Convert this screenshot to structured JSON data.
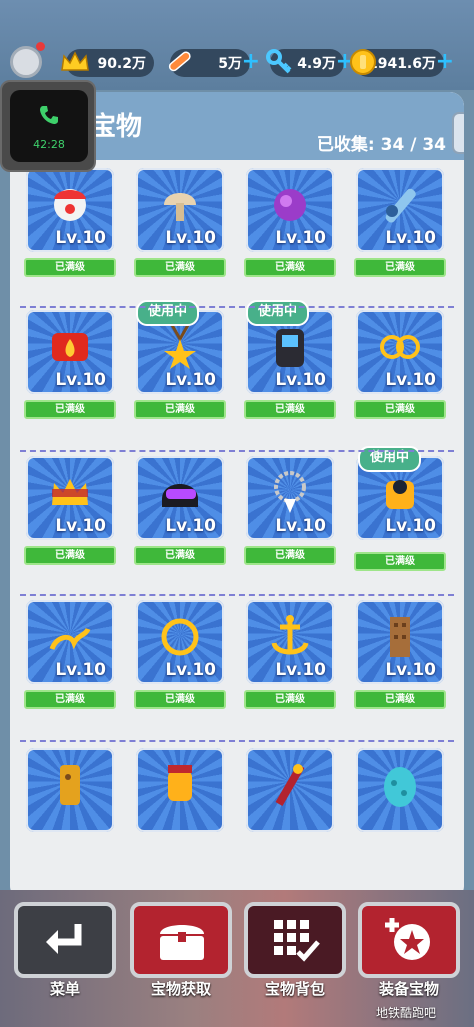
{
  "resources": [
    {
      "icon": "crown-icon",
      "value": "90.2万"
    },
    {
      "icon": "hoverboard-icon",
      "value": "5万"
    },
    {
      "icon": "key-icon",
      "value": "4.9万"
    },
    {
      "icon": "coin-icon",
      "value": "1941.6万"
    }
  ],
  "header": {
    "title": "宝物",
    "collected": "已收集: 34 / 34"
  },
  "call": {
    "time": "42:28"
  },
  "labels": {
    "maxed": "已满级",
    "in_use": "使用中"
  },
  "treasures": [
    {
      "icon": "clown-mask-icon",
      "level": "Lv.10",
      "in_use": false
    },
    {
      "icon": "mushroom-icon",
      "level": "Lv.10",
      "in_use": false
    },
    {
      "icon": "purple-orb-icon",
      "level": "Lv.10",
      "in_use": false
    },
    {
      "icon": "wrench-icon",
      "level": "Lv.10",
      "in_use": false
    },
    {
      "icon": "fire-badge-icon",
      "level": "Lv.10",
      "in_use": false
    },
    {
      "icon": "star-medal-icon",
      "level": "Lv.10",
      "in_use": true
    },
    {
      "icon": "device-icon",
      "level": "Lv.10",
      "in_use": true
    },
    {
      "icon": "gold-rings-icon",
      "level": "Lv.10",
      "in_use": false
    },
    {
      "icon": "crown-treasure-icon",
      "level": "Lv.10",
      "in_use": false
    },
    {
      "icon": "helmet-icon",
      "level": "Lv.10",
      "in_use": false
    },
    {
      "icon": "tooth-necklace-icon",
      "level": "Lv.10",
      "in_use": false
    },
    {
      "icon": "gold-cup-icon",
      "level": "Lv.10",
      "in_use": true
    },
    {
      "icon": "gold-lamp-icon",
      "level": "Lv.10",
      "in_use": false
    },
    {
      "icon": "gold-ring-icon",
      "level": "Lv.10",
      "in_use": false
    },
    {
      "icon": "anchor-icon",
      "level": "Lv.10",
      "in_use": false
    },
    {
      "icon": "tower-icon",
      "level": "Lv.10",
      "in_use": false
    },
    {
      "icon": "golden-statue-icon",
      "level": "",
      "in_use": false
    },
    {
      "icon": "lantern-icon",
      "level": "",
      "in_use": false
    },
    {
      "icon": "staff-icon",
      "level": "",
      "in_use": false
    },
    {
      "icon": "egg-icon",
      "level": "",
      "in_use": false
    }
  ],
  "nav": [
    {
      "icon": "back-arrow-icon",
      "label": "菜单"
    },
    {
      "icon": "chest-icon",
      "label": "宝物获取"
    },
    {
      "icon": "grid-check-icon",
      "label": "宝物背包"
    },
    {
      "icon": "equip-treasure-icon",
      "label": "装备宝物"
    }
  ],
  "watermark": "地铁酷跑吧",
  "colors": {
    "card_blue": "#3a73d0",
    "maxed_green": "#3fb83a",
    "in_use_teal": "#48b08a",
    "header_blue": "#7ea6c9"
  }
}
